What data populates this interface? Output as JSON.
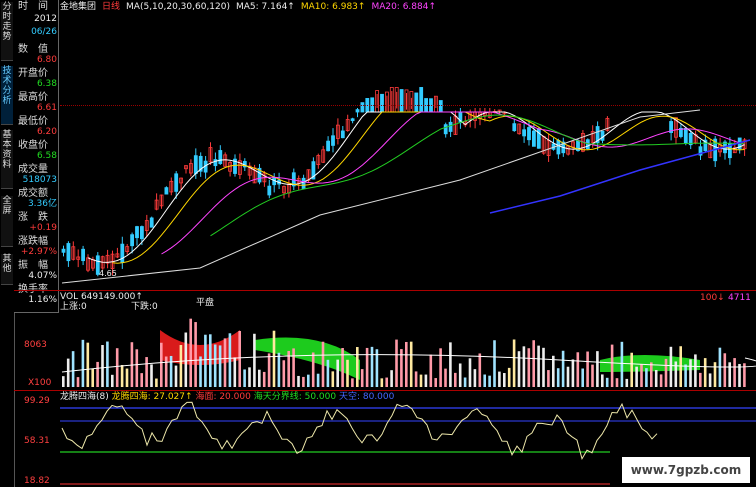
{
  "left_tabs": [
    {
      "label": "分时走势",
      "active": false
    },
    {
      "label": "技术分析",
      "active": true
    },
    {
      "label": "基本资料",
      "active": false
    },
    {
      "label": "全屏",
      "active": false
    },
    {
      "label": "其他",
      "active": false
    }
  ],
  "info_panel": {
    "time_label": "时　间",
    "year": "2012",
    "date": "06/26",
    "fields": [
      {
        "label": "数　值",
        "value": "6.80"
      },
      {
        "label": "开盘价",
        "value": "6.38"
      },
      {
        "label": "最高价",
        "value": "6.61"
      },
      {
        "label": "最低价",
        "value": "6.20"
      },
      {
        "label": "收盘价",
        "value": "6.58"
      },
      {
        "label": "成交量",
        "value": "518073"
      },
      {
        "label": "成交额",
        "value": "3.36亿"
      },
      {
        "label": "涨　跌",
        "value": "+0.19"
      },
      {
        "label": "涨跌幅",
        "value": "+2.97%"
      },
      {
        "label": "振　幅",
        "value": "4.07%"
      },
      {
        "label": "换手率",
        "value": "1.16%"
      }
    ]
  },
  "header": {
    "stock_name": "金地集团",
    "period": "日线",
    "ma_params": "MA(5,10,20,30,60,120)",
    "ma5": "MA5: 7.164↑",
    "ma10": "MA10: 6.983↑",
    "ma20": "MA20: 6.884↑"
  },
  "price_panel": {
    "low_annotation": "4.65"
  },
  "volume_panel": {
    "label": "VOL 649149.000↑",
    "sub_label": "上涨:0",
    "down_label": "下跌:0",
    "flat_label": "平盘",
    "axis_mid": "8063",
    "axis_unit": "X100",
    "right_label_a": "100↓",
    "right_label_b": "4711"
  },
  "indicator_panel": {
    "title": "龙腾四海(8)",
    "name": "龙腾四海: 27.027↑",
    "sea": "海面: 20.000",
    "boundary": "海天分界线: 50.000",
    "sky": "天空: 80.000",
    "axis_top": "99.29",
    "axis_mid": "58.31",
    "axis_bottom": "18.82"
  },
  "watermark": "www.7gpzb.com",
  "colors": {
    "up": "#ff3b3b",
    "down": "#33ccff",
    "ma5": "#ffffff",
    "ma10": "#ffd700",
    "ma20": "#ff44ff",
    "ma30": "#22cc22",
    "ma60": "#dddddd",
    "ma120": "#3333ff"
  }
}
